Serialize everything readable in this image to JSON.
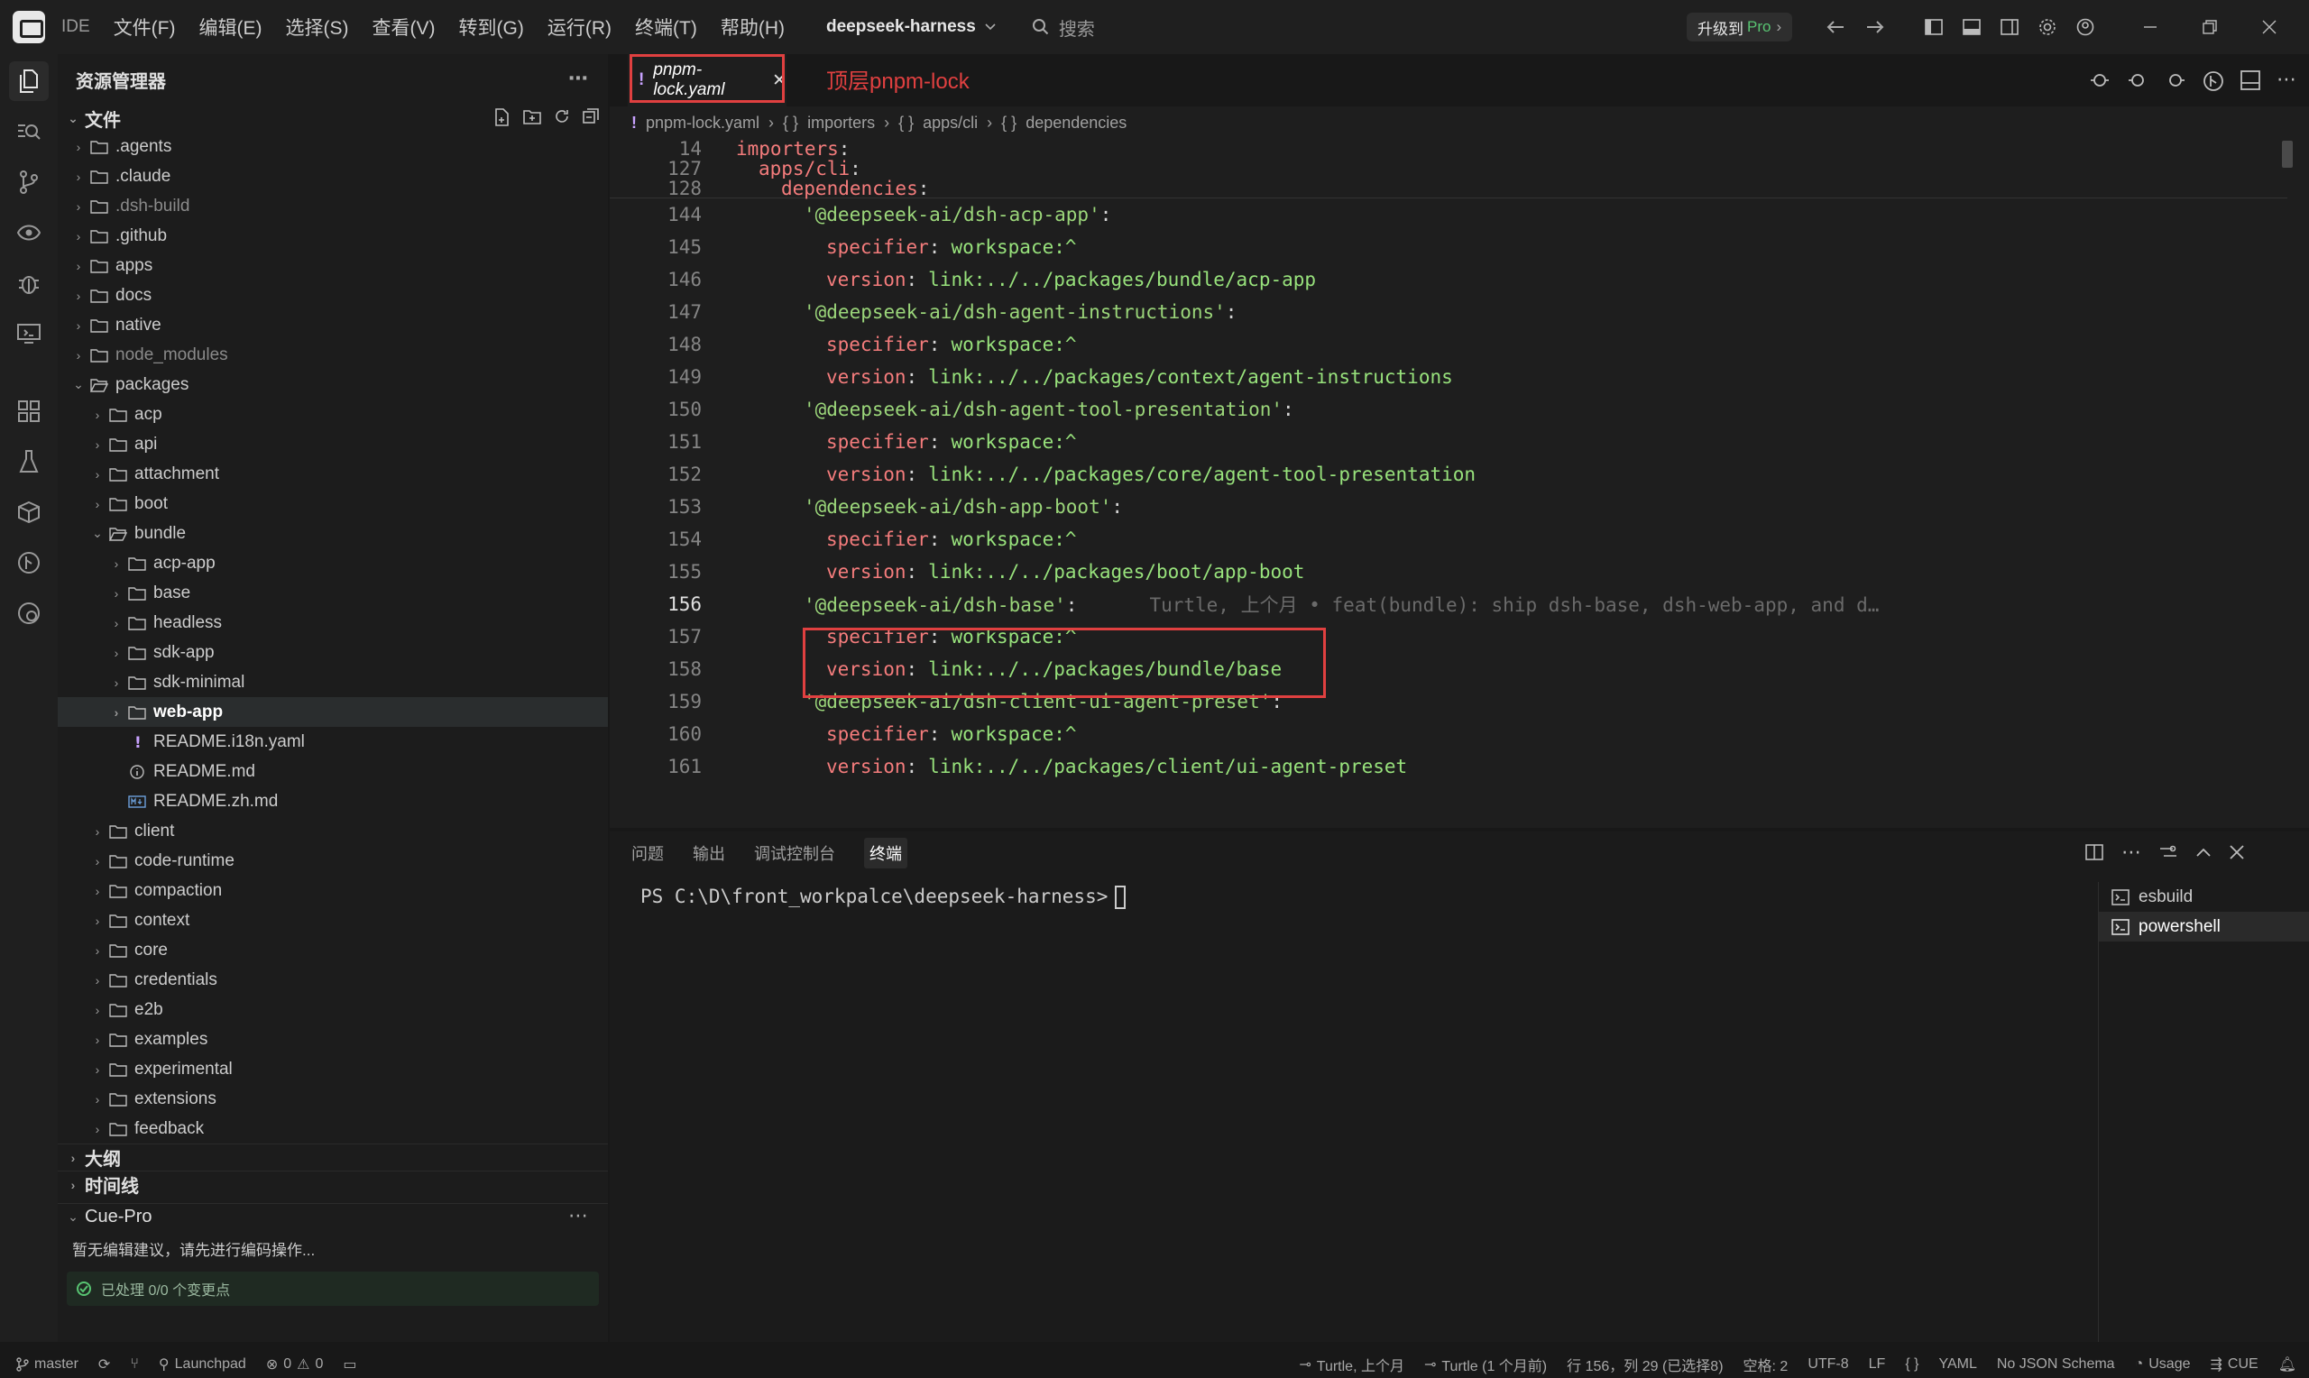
{
  "titlebar": {
    "app_label": "IDE",
    "menus": [
      "文件(F)",
      "编辑(E)",
      "选择(S)",
      "查看(V)",
      "转到(G)",
      "运行(R)",
      "终端(T)",
      "帮助(H)"
    ],
    "workspace": "deepseek-harness",
    "search_placeholder": "搜索",
    "upgrade_label": "升级到",
    "upgrade_pro": "Pro"
  },
  "sidebar": {
    "title": "资源管理器",
    "files_section": "文件",
    "tree": [
      {
        "label": ".agents",
        "depth": 0,
        "type": "folder",
        "dim": false
      },
      {
        "label": ".claude",
        "depth": 0,
        "type": "folder",
        "dim": false
      },
      {
        "label": ".dsh-build",
        "depth": 0,
        "type": "folder",
        "dim": true
      },
      {
        "label": ".github",
        "depth": 0,
        "type": "folder",
        "dim": false
      },
      {
        "label": "apps",
        "depth": 0,
        "type": "folder",
        "dim": false
      },
      {
        "label": "docs",
        "depth": 0,
        "type": "folder",
        "dim": false
      },
      {
        "label": "native",
        "depth": 0,
        "type": "folder",
        "dim": false
      },
      {
        "label": "node_modules",
        "depth": 0,
        "type": "folder",
        "dim": true
      },
      {
        "label": "packages",
        "depth": 0,
        "type": "folder-open",
        "dim": false
      },
      {
        "label": "acp",
        "depth": 1,
        "type": "folder",
        "dim": false
      },
      {
        "label": "api",
        "depth": 1,
        "type": "folder",
        "dim": false
      },
      {
        "label": "attachment",
        "depth": 1,
        "type": "folder",
        "dim": false
      },
      {
        "label": "boot",
        "depth": 1,
        "type": "folder",
        "dim": false
      },
      {
        "label": "bundle",
        "depth": 1,
        "type": "folder-open",
        "dim": false
      },
      {
        "label": "acp-app",
        "depth": 2,
        "type": "folder",
        "dim": false
      },
      {
        "label": "base",
        "depth": 2,
        "type": "folder",
        "dim": false
      },
      {
        "label": "headless",
        "depth": 2,
        "type": "folder",
        "dim": false
      },
      {
        "label": "sdk-app",
        "depth": 2,
        "type": "folder",
        "dim": false
      },
      {
        "label": "sdk-minimal",
        "depth": 2,
        "type": "folder",
        "dim": false
      },
      {
        "label": "web-app",
        "depth": 2,
        "type": "folder",
        "dim": false,
        "selected": true
      },
      {
        "label": "README.i18n.yaml",
        "depth": 2,
        "type": "yaml",
        "dim": false
      },
      {
        "label": "README.md",
        "depth": 2,
        "type": "info",
        "dim": false
      },
      {
        "label": "README.zh.md",
        "depth": 2,
        "type": "md",
        "dim": false
      },
      {
        "label": "client",
        "depth": 1,
        "type": "folder",
        "dim": false
      },
      {
        "label": "code-runtime",
        "depth": 1,
        "type": "folder",
        "dim": false
      },
      {
        "label": "compaction",
        "depth": 1,
        "type": "folder",
        "dim": false
      },
      {
        "label": "context",
        "depth": 1,
        "type": "folder",
        "dim": false
      },
      {
        "label": "core",
        "depth": 1,
        "type": "folder",
        "dim": false
      },
      {
        "label": "credentials",
        "depth": 1,
        "type": "folder",
        "dim": false
      },
      {
        "label": "e2b",
        "depth": 1,
        "type": "folder",
        "dim": false
      },
      {
        "label": "examples",
        "depth": 1,
        "type": "folder",
        "dim": false
      },
      {
        "label": "experimental",
        "depth": 1,
        "type": "folder",
        "dim": false
      },
      {
        "label": "extensions",
        "depth": 1,
        "type": "folder",
        "dim": false
      },
      {
        "label": "feedback",
        "depth": 1,
        "type": "folder",
        "dim": false
      }
    ],
    "outline_section": "大纲",
    "timeline_section": "时间线",
    "cue_section": "Cue-Pro",
    "cue_hint": "暂无编辑建议，请先进行编码操作...",
    "cue_status": "已处理 0/0 个变更点"
  },
  "editor": {
    "tab_label": "pnpm-lock.yaml",
    "tab_annotation": "顶层pnpm-lock",
    "breadcrumb": [
      "pnpm-lock.yaml",
      "importers",
      "apps/cli",
      "dependencies"
    ],
    "lines": [
      {
        "n": "14",
        "indent": 0,
        "key": "importers",
        "val": "",
        "kind": "key"
      },
      {
        "n": "127",
        "indent": 1,
        "key": "apps/cli",
        "val": "",
        "kind": "key"
      },
      {
        "n": "128",
        "indent": 2,
        "key": "dependencies",
        "val": "",
        "kind": "key"
      },
      {
        "n": "144",
        "indent": 3,
        "key": "'@deepseek-ai/dsh-acp-app'",
        "val": "",
        "kind": "str"
      },
      {
        "n": "145",
        "indent": 4,
        "key": "specifier",
        "val": "workspace:^",
        "kind": "key"
      },
      {
        "n": "146",
        "indent": 4,
        "key": "version",
        "val": "link:../../packages/bundle/acp-app",
        "kind": "key"
      },
      {
        "n": "147",
        "indent": 3,
        "key": "'@deepseek-ai/dsh-agent-instructions'",
        "val": "",
        "kind": "str"
      },
      {
        "n": "148",
        "indent": 4,
        "key": "specifier",
        "val": "workspace:^",
        "kind": "key"
      },
      {
        "n": "149",
        "indent": 4,
        "key": "version",
        "val": "link:../../packages/context/agent-instructions",
        "kind": "key"
      },
      {
        "n": "150",
        "indent": 3,
        "key": "'@deepseek-ai/dsh-agent-tool-presentation'",
        "val": "",
        "kind": "str"
      },
      {
        "n": "151",
        "indent": 4,
        "key": "specifier",
        "val": "workspace:^",
        "kind": "key"
      },
      {
        "n": "152",
        "indent": 4,
        "key": "version",
        "val": "link:../../packages/core/agent-tool-presentation",
        "kind": "key"
      },
      {
        "n": "153",
        "indent": 3,
        "key": "'@deepseek-ai/dsh-app-boot'",
        "val": "",
        "kind": "str"
      },
      {
        "n": "154",
        "indent": 4,
        "key": "specifier",
        "val": "workspace:^",
        "kind": "key"
      },
      {
        "n": "155",
        "indent": 4,
        "key": "version",
        "val": "link:../../packages/boot/app-boot",
        "kind": "key"
      },
      {
        "n": "156",
        "indent": 3,
        "key": "'@deepseek-ai/dsh-base'",
        "val": "",
        "kind": "str",
        "current": true,
        "blame": "Turtle, 上个月 • feat(bundle): ship dsh-base, dsh-web-app, and d…"
      },
      {
        "n": "157",
        "indent": 4,
        "key": "specifier",
        "val": "workspace:^",
        "kind": "key"
      },
      {
        "n": "158",
        "indent": 4,
        "key": "version",
        "val": "link:../../packages/bundle/base",
        "kind": "key"
      },
      {
        "n": "159",
        "indent": 3,
        "key": "'@deepseek-ai/dsh-client-ui-agent-preset'",
        "val": "",
        "kind": "str"
      },
      {
        "n": "160",
        "indent": 4,
        "key": "specifier",
        "val": "workspace:^",
        "kind": "key"
      },
      {
        "n": "161",
        "indent": 4,
        "key": "version",
        "val": "link:../../packages/client/ui-agent-preset",
        "kind": "key"
      }
    ]
  },
  "panel": {
    "tabs": [
      "问题",
      "输出",
      "调试控制台",
      "终端"
    ],
    "active_tab": "终端",
    "prompt": "PS C:\\D\\front_workpalce\\deepseek-harness>",
    "terminals": [
      "esbuild",
      "powershell"
    ]
  },
  "statusbar": {
    "branch": "master",
    "launchpad": "Launchpad",
    "errors": "0",
    "warnings": "0",
    "blame_short": "Turtle, 上个月",
    "blame_long": "Turtle (1 个月前)",
    "position": "行 156，列 29 (已选择8)",
    "spaces": "空格: 2",
    "encoding": "UTF-8",
    "eol": "LF",
    "braces": "{ }",
    "language": "YAML",
    "schema": "No JSON Schema",
    "usage": "Usage",
    "cue": "CUE"
  },
  "colors": {
    "accent": "#e04040",
    "key": "#f47c7c",
    "value": "#98e27c"
  }
}
